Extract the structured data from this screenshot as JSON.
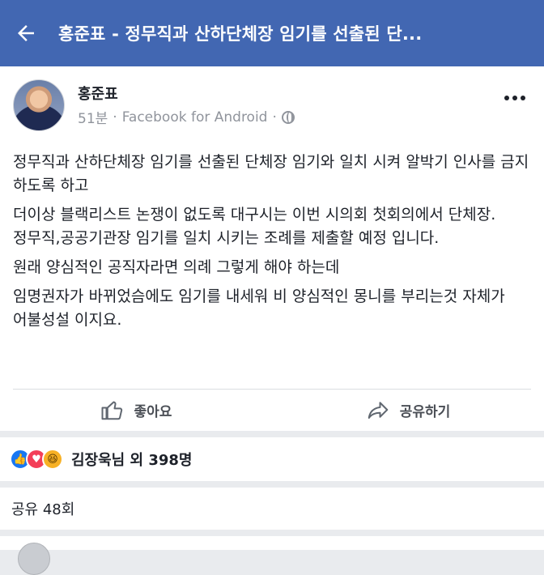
{
  "topbar": {
    "title": "홍준표 - 정무직과 산하단체장 임기를 선출된 단..."
  },
  "post": {
    "author": "홍준표",
    "time": "51분",
    "separator": "·",
    "source": "Facebook for Android",
    "paragraphs": [
      "정무직과 산하단체장 임기를 선출된 단체장 임기와 일치 시켜 알박기 인사를 금지 하도록 하고",
      "더이상 블랙리스트 논쟁이 없도록 대구시는 이번 시의회 첫회의에서 단체장.정무직,공공기관장 임기를 일치 시키는 조례를 제출할 예정 입니다.",
      "원래 양심적인 공직자라면 의례 그렇게 해야 하는데",
      "임명권자가 바뀌었슴에도 임기를 내세워 비 양심적인 몽니를 부리는것 자체가 어불성설 이지요."
    ],
    "like_label": "좋아요",
    "share_label": "공유하기"
  },
  "reactions": {
    "summary": "김장욱님 외 398명",
    "icons": [
      "like-icon",
      "love-icon",
      "haha-icon"
    ]
  },
  "shares": {
    "text": "공유 48회"
  },
  "colors": {
    "brand": "#4267b2",
    "meta": "#90949c",
    "like": "#1877f2",
    "love": "#f33e58",
    "haha": "#f7b125"
  }
}
